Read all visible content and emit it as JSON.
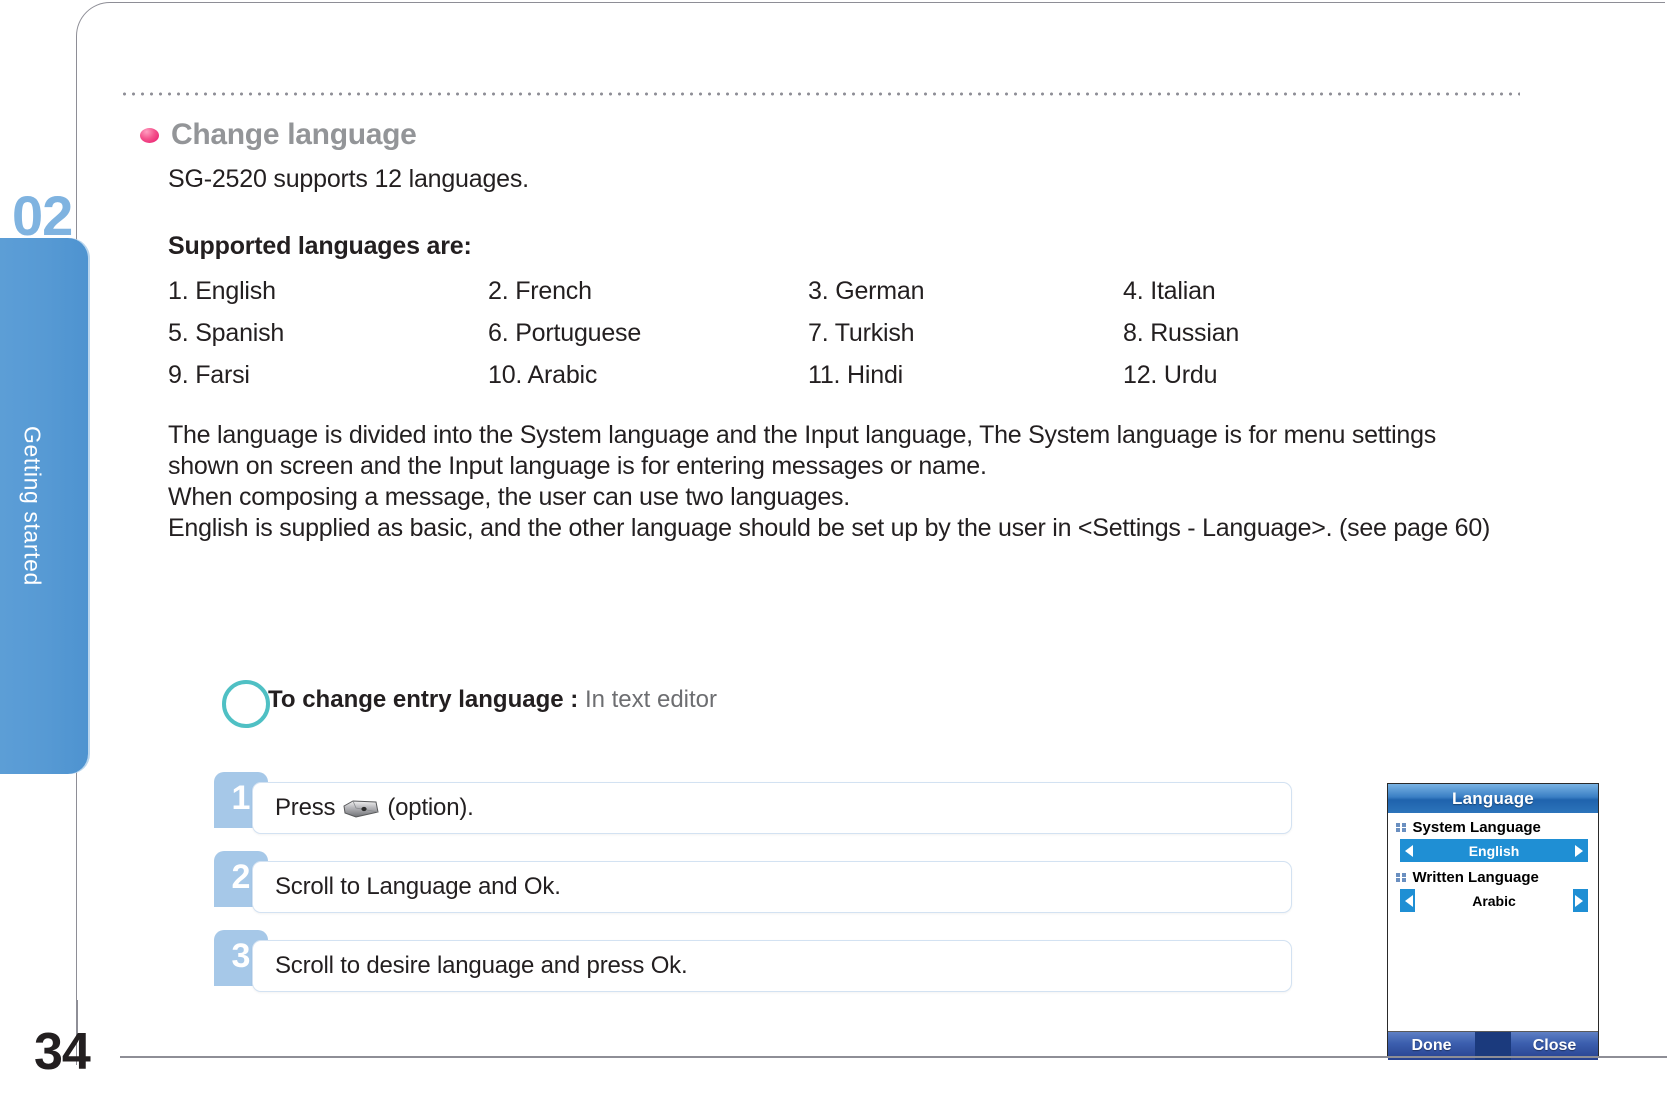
{
  "chapter": {
    "number": "02",
    "label": "Getting started"
  },
  "section": {
    "heading": "Change language",
    "intro": "SG-2520 supports 12 languages.",
    "supported_heading": "Supported languages are:"
  },
  "languages": [
    "1. English",
    "2. French",
    "3. German",
    "4. Italian",
    "5. Spanish",
    "6. Portuguese",
    "7. Turkish",
    "8. Russian",
    "9. Farsi",
    "10. Arabic",
    "11. Hindi",
    "12. Urdu"
  ],
  "paragraph": {
    "line1": "The language is divided into the System language and the Input language, The System language is for menu settings",
    "line2": "shown on screen and the Input language is for entering messages or name.",
    "line3": "When composing a message, the user can use two languages.",
    "line4": "English is supplied as basic, and the other language should be set up by the user in <Settings - Language>. (see page 60)"
  },
  "procedure": {
    "title_bold": "To change entry language :",
    "title_subtle": "In text editor",
    "steps": [
      {
        "number": "1",
        "text_before": "Press",
        "icon": "option-key-icon",
        "text_after": "(option)."
      },
      {
        "number": "2",
        "text_before": "Scroll to Language and Ok.",
        "icon": "",
        "text_after": ""
      },
      {
        "number": "3",
        "text_before": "Scroll to desire language and press Ok.",
        "icon": "",
        "text_after": ""
      }
    ]
  },
  "phone_screen": {
    "title": "Language",
    "fields": [
      {
        "label": "System Language",
        "value": "English",
        "selected": true
      },
      {
        "label": "Written Language",
        "value": "Arabic",
        "selected": false
      }
    ],
    "softkeys": {
      "left": "Done",
      "right": "Close"
    }
  },
  "footer": {
    "page_number": "34"
  },
  "colors": {
    "tab_blue": "#5a9bd5",
    "heading_gray": "#939598",
    "bullet_pink": "#e8156b",
    "step_badge": "#a6c8e8",
    "ring_teal": "#4fc0c4",
    "screen_blue": "#1f8fd4"
  }
}
